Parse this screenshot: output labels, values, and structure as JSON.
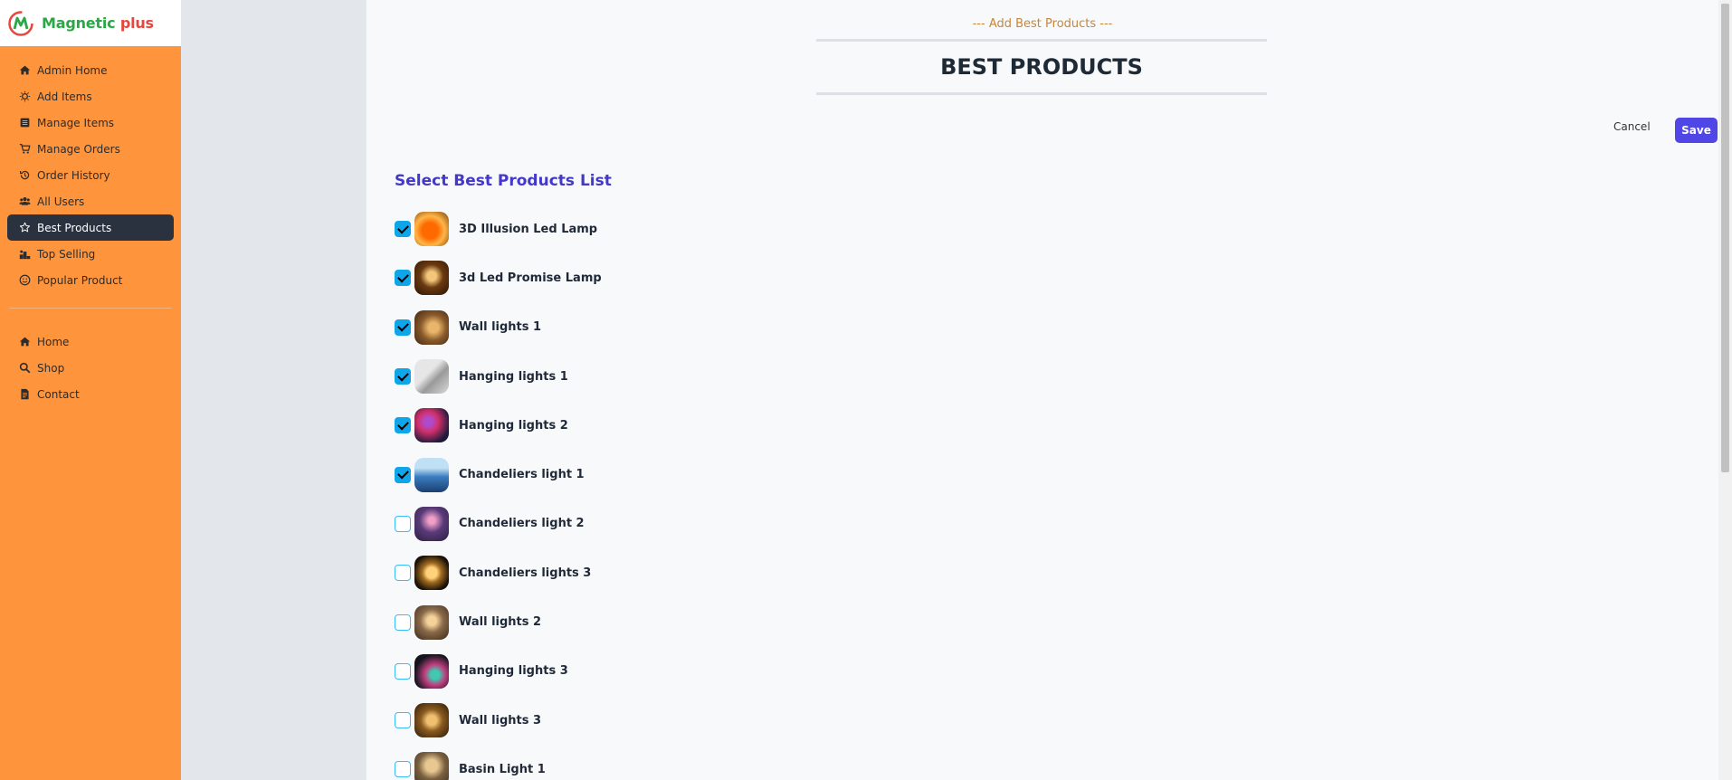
{
  "brand": {
    "name_part1": "Magnetic",
    "name_part2": "plus",
    "colors": {
      "green": "#29a845",
      "red": "#e8453c"
    }
  },
  "sidebar": {
    "accent": "#fe943b",
    "items": [
      {
        "label": "Admin Home",
        "icon": "home-icon"
      },
      {
        "label": "Add Items",
        "icon": "bulb-icon"
      },
      {
        "label": "Manage Items",
        "icon": "list-icon"
      },
      {
        "label": "Manage Orders",
        "icon": "cart-icon"
      },
      {
        "label": "Order History",
        "icon": "history-icon"
      },
      {
        "label": "All Users",
        "icon": "users-icon"
      },
      {
        "label": "Best Products",
        "icon": "star-icon",
        "active": true
      },
      {
        "label": "Top Selling",
        "icon": "podium-icon"
      },
      {
        "label": "Popular Product",
        "icon": "smile-icon"
      }
    ],
    "links": [
      {
        "label": "Home",
        "icon": "home-icon"
      },
      {
        "label": "Shop",
        "icon": "search-icon"
      },
      {
        "label": "Contact",
        "icon": "document-icon"
      }
    ]
  },
  "header": {
    "subtitle": "--- Add Best Products ---",
    "title": "BEST PRODUCTS"
  },
  "actions": {
    "cancel_label": "Cancel",
    "save_label": "Save"
  },
  "list": {
    "heading": "Select Best Products List",
    "items": [
      {
        "name": "3D Illusion Led Lamp",
        "checked": true
      },
      {
        "name": "3d Led Promise Lamp",
        "checked": true
      },
      {
        "name": "Wall lights 1",
        "checked": true
      },
      {
        "name": "Hanging lights 1",
        "checked": true
      },
      {
        "name": "Hanging lights 2",
        "checked": true
      },
      {
        "name": "Chandeliers light 1",
        "checked": true
      },
      {
        "name": "Chandeliers light 2",
        "checked": false
      },
      {
        "name": "Chandeliers lights 3",
        "checked": false
      },
      {
        "name": "Wall lights 2",
        "checked": false
      },
      {
        "name": "Hanging lights 3",
        "checked": false
      },
      {
        "name": "Wall lights 3",
        "checked": false
      },
      {
        "name": "Basin Light 1",
        "checked": false
      }
    ]
  }
}
